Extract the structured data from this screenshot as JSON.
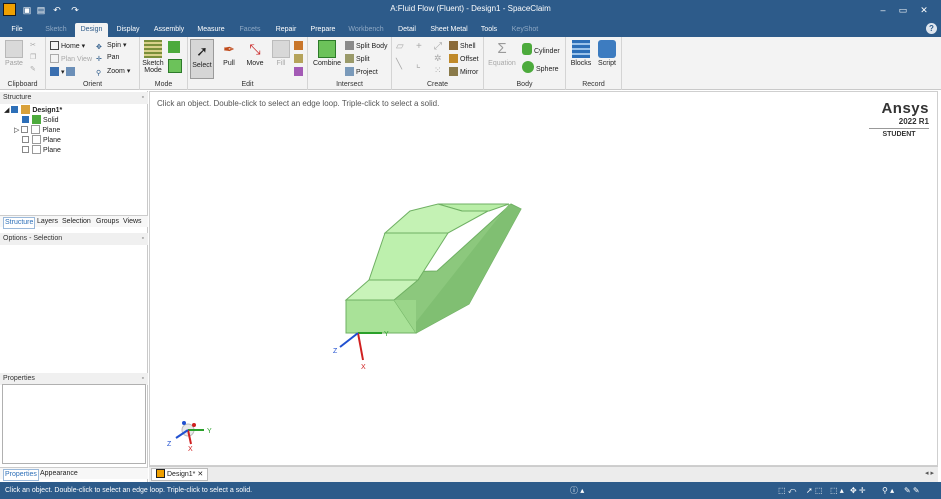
{
  "window": {
    "title": "A:Fluid Flow (Fluent) - Design1 - SpaceClaim",
    "controls": [
      "–",
      "▭",
      "✕"
    ]
  },
  "quick_access": [
    "open-icon",
    "save-icon",
    "undo-icon",
    "redo-icon"
  ],
  "tabs": [
    {
      "label": "File",
      "state": "file"
    },
    {
      "label": "Sketch",
      "state": "dim"
    },
    {
      "label": "Design",
      "state": "active"
    },
    {
      "label": "Display",
      "state": "normal"
    },
    {
      "label": "Assembly",
      "state": "normal"
    },
    {
      "label": "Measure",
      "state": "normal"
    },
    {
      "label": "Facets",
      "state": "dim"
    },
    {
      "label": "Repair",
      "state": "normal"
    },
    {
      "label": "Prepare",
      "state": "normal"
    },
    {
      "label": "Workbench",
      "state": "dim"
    },
    {
      "label": "Detail",
      "state": "normal"
    },
    {
      "label": "Sheet Metal",
      "state": "normal"
    },
    {
      "label": "Tools",
      "state": "normal"
    },
    {
      "label": "KeyShot",
      "state": "dim"
    }
  ],
  "ribbon": {
    "clipboard": {
      "label": "Clipboard",
      "paste": "Paste"
    },
    "orient": {
      "label": "Orient",
      "home": "Home",
      "plan_view": "Plan View",
      "spin": "Spin",
      "pan": "Pan",
      "zoom": "Zoom"
    },
    "mode": {
      "label": "Mode",
      "sketch_mode": "Sketch Mode"
    },
    "edit": {
      "label": "Edit",
      "select": "Select",
      "pull": "Pull",
      "move": "Move",
      "fill": "Fill"
    },
    "intersect": {
      "label": "Intersect",
      "combine": "Combine",
      "split_body": "Split Body",
      "split": "Split",
      "project": "Project"
    },
    "create": {
      "label": "Create",
      "shell": "Shell",
      "offset": "Offset",
      "mirror": "Mirror"
    },
    "body": {
      "label": "Body",
      "equation": "Equation",
      "cylinder": "Cylinder",
      "sphere": "Sphere"
    },
    "record": {
      "label": "Record",
      "blocks": "Blocks",
      "script": "Script"
    }
  },
  "structure": {
    "header": "Structure",
    "items": [
      {
        "label": "Design1*",
        "checked": true,
        "expanded": true
      },
      {
        "label": "Solid",
        "checked": true
      },
      {
        "label": "Plane",
        "checked": false,
        "collapsed": true
      },
      {
        "label": "Plane",
        "checked": false
      },
      {
        "label": "Plane",
        "checked": false
      }
    ]
  },
  "panel_tabs": [
    "Structure",
    "Layers",
    "Selection",
    "Groups",
    "Views"
  ],
  "options_header": "Options - Selection",
  "properties_header": "Properties",
  "bottom_tabs": [
    "Properties",
    "Appearance"
  ],
  "viewport": {
    "hint": "Click an object. Double-click to select an edge loop. Triple-click to select a solid.",
    "brand": "Ansys",
    "version": "2022 R1",
    "edition": "STUDENT",
    "axis_labels": {
      "x": "X",
      "y": "Y",
      "z": "Z"
    }
  },
  "document_tab": "Design1*",
  "status": {
    "message": "Click an object. Double-click to select an edge loop. Triple-click to select a solid."
  },
  "colors": {
    "titlebar": "#2d5b8a",
    "solid_top": "#c8f0b8",
    "solid_front": "#a8e097",
    "solid_side": "#86c678",
    "solid_edge": "#6fb063"
  }
}
